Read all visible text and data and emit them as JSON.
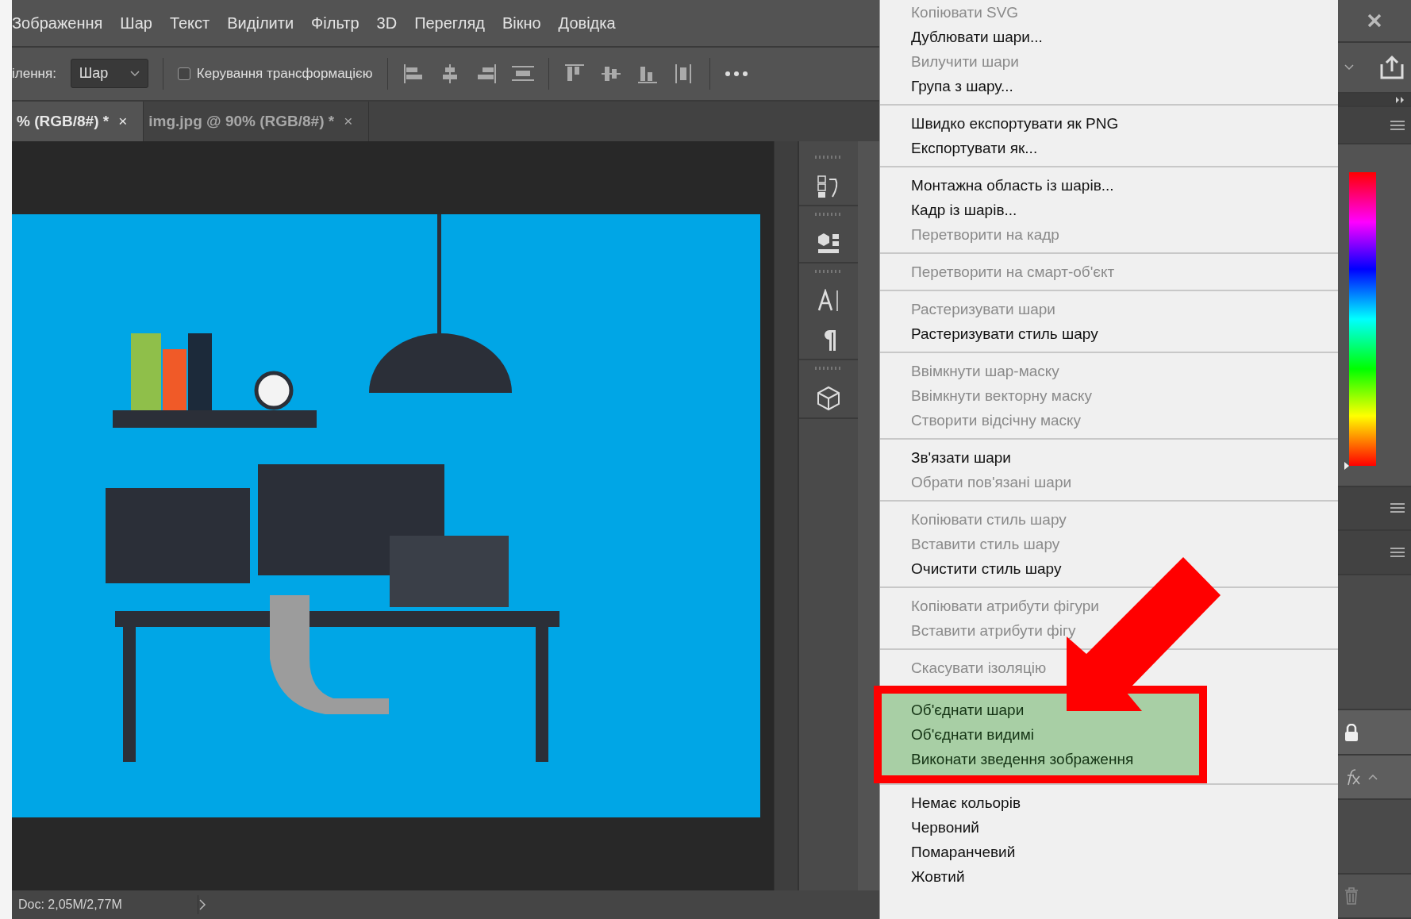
{
  "menu_bar": [
    "Зображення",
    "Шар",
    "Текст",
    "Виділити",
    "Фільтр",
    "3D",
    "Перегляд",
    "Вікно",
    "Довідка"
  ],
  "options_bar": {
    "label": "ілення:",
    "select": "Шар",
    "checkbox": {
      "label": "Керування трансформацією",
      "checked": false
    }
  },
  "tabs": [
    {
      "label": "% (RGB/8#) *",
      "close": "×",
      "selected": true
    },
    {
      "label": "img.jpg @ 90% (RGB/8#) *",
      "close": "×",
      "selected": false
    }
  ],
  "status_bar": {
    "doc": "Doc: 2,05M/2,77M"
  },
  "context_menu": {
    "groups": [
      {
        "highlighted": false,
        "items": [
          {
            "label": "Копіювати SVG",
            "disabled": true
          },
          {
            "label": "Дублювати шари...",
            "disabled": false
          },
          {
            "label": "Вилучити шари",
            "disabled": true
          },
          {
            "label": "Група з шару...",
            "disabled": false
          }
        ]
      },
      {
        "highlighted": false,
        "items": [
          {
            "label": "Швидко експортувати як PNG",
            "disabled": false
          },
          {
            "label": "Експортувати як...",
            "disabled": false
          }
        ]
      },
      {
        "highlighted": false,
        "items": [
          {
            "label": "Монтажна область із шарів...",
            "disabled": false
          },
          {
            "label": "Кадр із шарів...",
            "disabled": false
          },
          {
            "label": "Перетворити на кадр",
            "disabled": true
          }
        ]
      },
      {
        "highlighted": false,
        "items": [
          {
            "label": "Перетворити на смарт-об'єкт",
            "disabled": true
          }
        ]
      },
      {
        "highlighted": false,
        "items": [
          {
            "label": "Растеризувати шари",
            "disabled": true
          },
          {
            "label": "Растеризувати стиль шару",
            "disabled": false
          }
        ]
      },
      {
        "highlighted": false,
        "items": [
          {
            "label": "Ввімкнути шар-маску",
            "disabled": true
          },
          {
            "label": "Ввімкнути векторну маску",
            "disabled": true
          },
          {
            "label": "Створити відсічну маску",
            "disabled": true
          }
        ]
      },
      {
        "highlighted": false,
        "items": [
          {
            "label": "Зв'язати шари",
            "disabled": false
          },
          {
            "label": "Обрати пов'язані шари",
            "disabled": true
          }
        ]
      },
      {
        "highlighted": false,
        "items": [
          {
            "label": "Копіювати стиль шару",
            "disabled": true
          },
          {
            "label": "Вставити стиль шару",
            "disabled": true
          },
          {
            "label": "Очистити стиль шару",
            "disabled": false
          }
        ]
      },
      {
        "highlighted": false,
        "items": [
          {
            "label": "Копіювати атрибути фігури",
            "disabled": true
          },
          {
            "label": "Вставити атрибути фігу",
            "disabled": true
          }
        ]
      },
      {
        "highlighted": false,
        "items": [
          {
            "label": "Скасувати ізоляцію",
            "disabled": true
          }
        ]
      },
      {
        "highlighted": true,
        "items": [
          {
            "label": "Об'єднати шари",
            "disabled": false
          },
          {
            "label": "Об'єднати видимі",
            "disabled": false
          },
          {
            "label": "Виконати зведення зображення",
            "disabled": false
          }
        ]
      },
      {
        "highlighted": false,
        "items": [
          {
            "label": "Немає кольорів",
            "disabled": false
          },
          {
            "label": "Червоний",
            "disabled": false
          },
          {
            "label": "Помаранчевий",
            "disabled": false
          },
          {
            "label": "Жовтий",
            "disabled": false
          }
        ]
      }
    ]
  }
}
